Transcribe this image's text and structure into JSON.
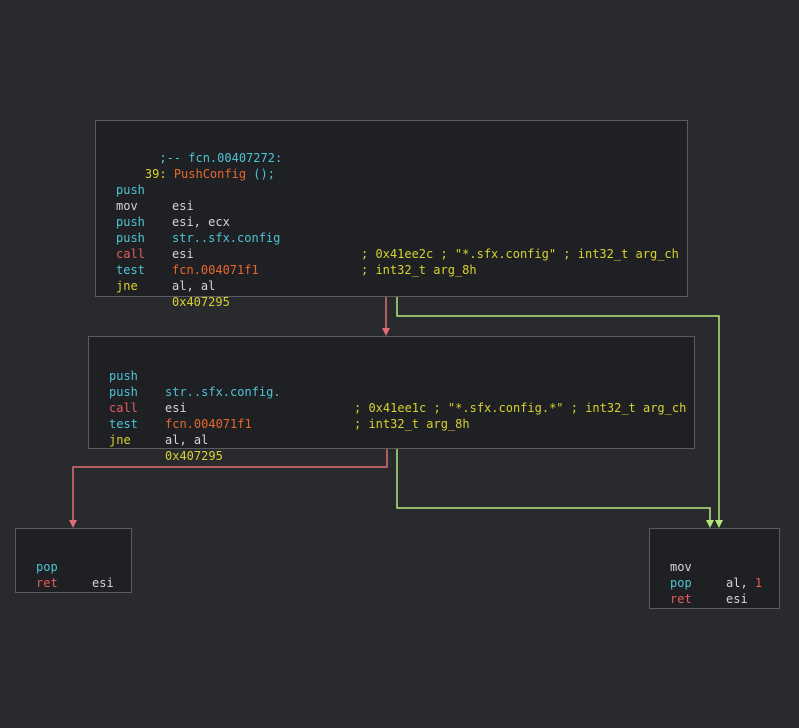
{
  "blocks": {
    "b1": {
      "label": "  ;-- fcn.00407272:",
      "func_prefix": "39: ",
      "func_name": "PushConfig",
      "func_suffix": " ();",
      "lines": [
        {
          "op": "push",
          "arg": "esi",
          "cmt": ""
        },
        {
          "op": "mov",
          "arg": "esi, ecx",
          "cmt": ""
        },
        {
          "op": "push",
          "arg": "str..sfx.config",
          "cmt": "; 0x41ee2c ; \"*.sfx.config\" ; int32_t arg_ch"
        },
        {
          "op": "push",
          "arg": "esi",
          "cmt": "; int32_t arg_8h"
        },
        {
          "op": "call",
          "arg": "fcn.004071f1",
          "cmt": ""
        },
        {
          "op": "test",
          "arg": "al, al",
          "cmt": ""
        },
        {
          "op": "jne",
          "arg": "0x407295",
          "cmt": ""
        }
      ]
    },
    "b2": {
      "lines": [
        {
          "op": "push",
          "arg": "str..sfx.config.",
          "cmt": "; 0x41ee1c ; \"*.sfx.config.*\" ; int32_t arg_ch"
        },
        {
          "op": "push",
          "arg": "esi",
          "cmt": "; int32_t arg_8h"
        },
        {
          "op": "call",
          "arg": "fcn.004071f1",
          "cmt": ""
        },
        {
          "op": "test",
          "arg": "al, al",
          "cmt": ""
        },
        {
          "op": "jne",
          "arg": "0x407295",
          "cmt": ""
        }
      ]
    },
    "b3": {
      "lines": [
        {
          "op": "pop",
          "arg": "esi"
        },
        {
          "op": "ret",
          "arg": ""
        }
      ]
    },
    "b4": {
      "lines": [
        {
          "op": "mov",
          "arg": "al, ",
          "num": "1"
        },
        {
          "op": "pop",
          "arg": "esi"
        },
        {
          "op": "ret",
          "arg": ""
        }
      ]
    }
  },
  "colors": {
    "background": "#282a2e",
    "node_bg": "#1e2023",
    "node_border": "#595b5f",
    "edge_false": "#e06c75",
    "edge_true": "#b5e67b",
    "mnemonic_cyan": "#4fc3d6",
    "mnemonic_red": "#e85d5d",
    "call": "#e8672e",
    "jump_yellow": "#d8d230"
  }
}
